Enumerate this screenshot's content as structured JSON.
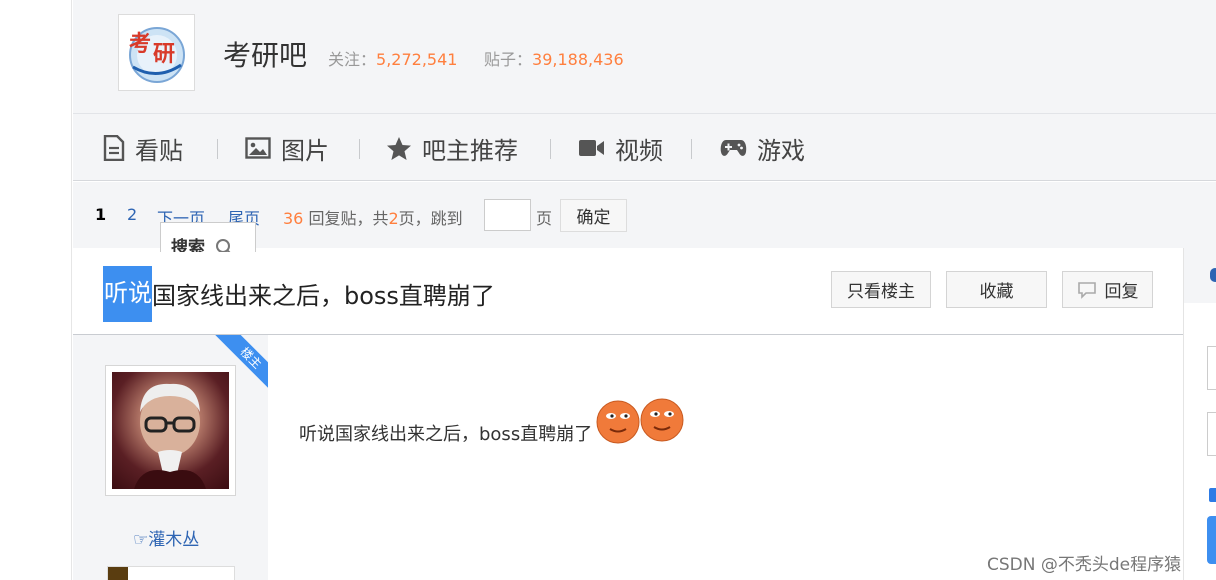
{
  "forum": {
    "name": "考研吧",
    "follow_label": "关注：",
    "follow_count": "5,272,541",
    "posts_label": "贴子：",
    "posts_count": "39,188,436"
  },
  "nav": {
    "items": [
      {
        "label": "看贴",
        "icon": "document-icon"
      },
      {
        "label": "图片",
        "icon": "image-icon"
      },
      {
        "label": "吧主推荐",
        "icon": "star-icon"
      },
      {
        "label": "视频",
        "icon": "video-camera-icon"
      },
      {
        "label": "游戏",
        "icon": "gamepad-icon"
      }
    ]
  },
  "pager": {
    "current": "1",
    "page2": "2",
    "next": "下一页",
    "last": "尾页",
    "reply_count": "36",
    "reply_text": "回复贴，共",
    "total_pages": "2",
    "pages_text": "页，跳到",
    "page_unit": "页",
    "confirm": "确定",
    "search_tab": "搜索"
  },
  "thread": {
    "title_highlight": "听说",
    "title_rest": "国家线出来之后，boss直聘崩了",
    "only_op": "只看楼主",
    "favorite": "收藏",
    "reply": "回复"
  },
  "post": {
    "badge": "楼主",
    "username": "☞灌木丛",
    "content": "听说国家线出来之后，boss直聘崩了"
  },
  "watermark": "CSDN @不秃头de程序猿",
  "colors": {
    "accent_orange": "#ff7f3e",
    "link_blue": "#2d64b3",
    "highlight_blue": "#3d8ff0"
  }
}
